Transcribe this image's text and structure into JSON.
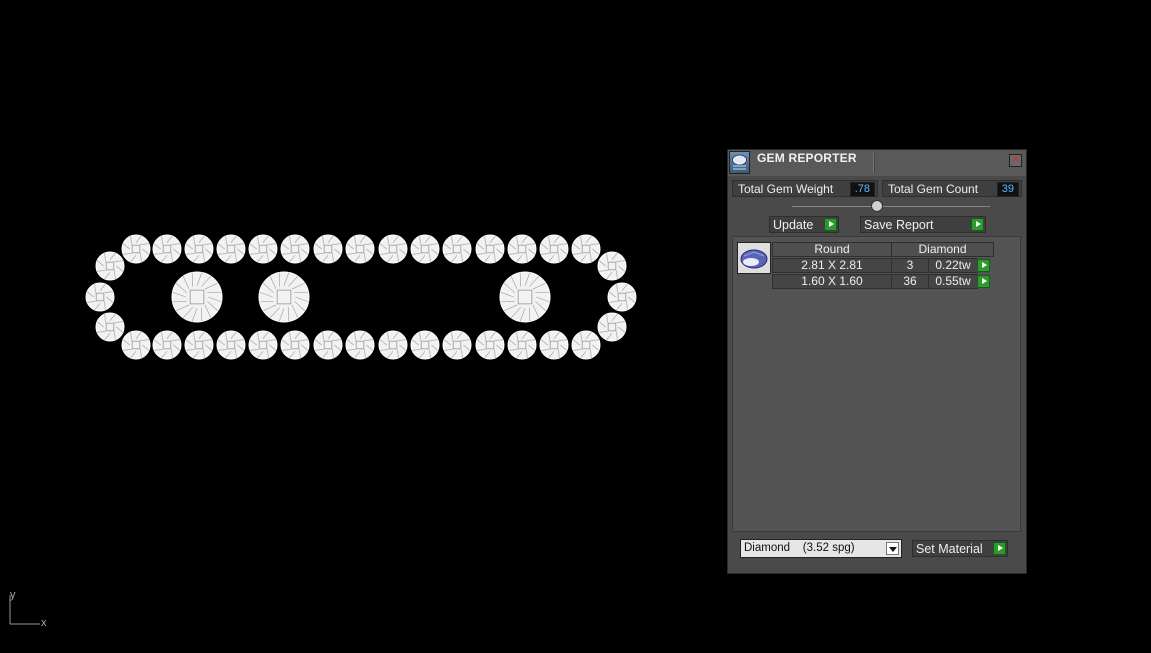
{
  "viewport": {
    "axis_y": "y",
    "axis_x": "x"
  },
  "panel": {
    "title": "GEM REPORTER",
    "close_glyph": "✕",
    "total_weight_label": "Total Gem Weight",
    "total_weight_value": ".78",
    "total_count_label": "Total Gem Count",
    "total_count_value": "39",
    "update_label": "Update",
    "save_report_label": "Save Report",
    "table": {
      "headers": [
        "Round",
        "Diamond"
      ],
      "rows": [
        {
          "size": "2.81 X 2.81",
          "count": "3",
          "weight": "0.22tw"
        },
        {
          "size": "1.60 X 1.60",
          "count": "36",
          "weight": "0.55tw"
        }
      ]
    },
    "material_selected": "Diamond    (3.52 spg)",
    "set_material_label": "Set Material"
  },
  "icons": {
    "title": "gem-reporter-icon",
    "close": "close-icon",
    "go": "play-arrow-icon",
    "dropdown": "chevron-down-icon",
    "thumb": "gem-thumbnail-icon"
  }
}
